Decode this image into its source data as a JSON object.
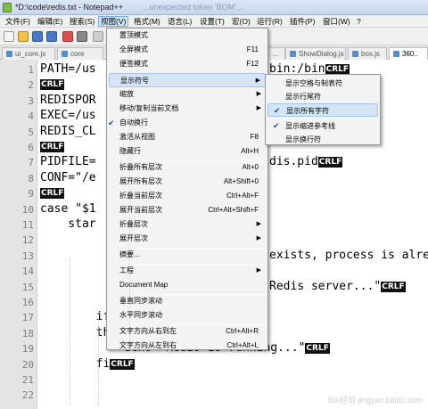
{
  "window": {
    "title": "*D:\\code\\redis.txt - Notepad++",
    "ghost_title": "...unexpected token 'BOM'..."
  },
  "menubar": {
    "items": [
      "文件(F)",
      "编辑(E)",
      "搜索(S)",
      "视图(V)",
      "格式(M)",
      "语言(L)",
      "设置(T)",
      "宏(O)",
      "运行(R)",
      "插件(P)",
      "窗口(W)",
      "?"
    ]
  },
  "tabs": [
    "ui_core.js",
    "core",
    "...",
    "ShowDialog.js",
    "box.js",
    "360.."
  ],
  "editor": {
    "line_numbers": [
      "1",
      "2",
      "3",
      "4",
      "5",
      "6",
      "7",
      "8",
      "9",
      "10",
      "11",
      "12",
      "13",
      "14",
      "15",
      "16",
      "17",
      "18",
      "19",
      "20",
      "21",
      "22"
    ],
    "lines": [
      {
        "text": "PATH=/us",
        "tail": "bin:/bin",
        "crlf": true
      },
      {
        "text": "",
        "crlf": true
      },
      {
        "text": "REDISPOR",
        "crlf": false
      },
      {
        "text": "EXEC=/us",
        "crlf": false
      },
      {
        "text": "REDIS_CL",
        "crlf": false
      },
      {
        "text": "",
        "crlf": true
      },
      {
        "text": "PIDFILE=",
        "tail": "dis.pid",
        "crlf": true
      },
      {
        "text": "CONF=\"/e",
        "crlf": false
      },
      {
        "text": "",
        "crlf": true
      },
      {
        "text": "case \"$1",
        "crlf": false
      },
      {
        "text": "    star",
        "crlf": false
      },
      {
        "text": "",
        "crlf": false
      },
      {
        "text": "",
        "tail": "exists, process is alre",
        "crlf": false
      },
      {
        "text": "",
        "crlf": false
      },
      {
        "text": "",
        "tail": "Redis server...\"",
        "crlf": true
      },
      {
        "text": "",
        "crlf": false
      },
      {
        "text": "        if [ \"$?\"=\"0\" ] ",
        "crlf": true
      },
      {
        "text": "        then",
        "crlf": true
      },
      {
        "text": "            echo \"Redis is running...\"",
        "crlf": true
      },
      {
        "text": "        fi",
        "crlf": true
      }
    ],
    "crlf_label": "CRLF"
  },
  "view_menu": {
    "items": [
      {
        "label": "置顶模式",
        "shortcut": ""
      },
      {
        "label": "全屏模式",
        "shortcut": "F11"
      },
      {
        "label": "便签模式",
        "shortcut": "F12"
      },
      {
        "label": "显示符号",
        "shortcut": "",
        "submenu": true
      },
      {
        "label": "缩放",
        "shortcut": "",
        "submenu": true
      },
      {
        "label": "移动/复制当前文档",
        "shortcut": "",
        "submenu": true
      },
      {
        "label": "自动换行",
        "shortcut": "",
        "checked": true
      },
      {
        "label": "激活从视图",
        "shortcut": "F8"
      },
      {
        "label": "隐藏行",
        "shortcut": "Alt+H"
      },
      {
        "label": "折叠所有层次",
        "shortcut": "Alt+0"
      },
      {
        "label": "展开所有层次",
        "shortcut": "Alt+Shift+0"
      },
      {
        "label": "折叠当前层次",
        "shortcut": "Ctrl+Alt+F"
      },
      {
        "label": "展开当前层次",
        "shortcut": "Ctrl+Alt+Shift+F"
      },
      {
        "label": "折叠层次",
        "shortcut": "",
        "submenu": true
      },
      {
        "label": "展开层次",
        "shortcut": "",
        "submenu": true
      },
      {
        "label": "摘要...",
        "shortcut": ""
      },
      {
        "label": "工程",
        "shortcut": "",
        "submenu": true
      },
      {
        "label": "Document Map",
        "shortcut": ""
      },
      {
        "label": "垂直同步滚动",
        "shortcut": ""
      },
      {
        "label": "水平同步滚动",
        "shortcut": ""
      },
      {
        "label": "文字方向从右到左",
        "shortcut": "Ctrl+Alt+R"
      },
      {
        "label": "文字方向从左到右",
        "shortcut": "Ctrl+Alt+L"
      }
    ]
  },
  "symbols_submenu": {
    "items": [
      {
        "label": "显示空格与制表符",
        "checked": false
      },
      {
        "label": "显示行尾符",
        "checked": false
      },
      {
        "label": "显示所有字符",
        "checked": true
      },
      {
        "label": "显示缩进参考线",
        "checked": true
      },
      {
        "label": "显示换行符",
        "checked": false
      }
    ]
  },
  "watermark": "Bai经验 jingyan.baidu.com",
  "colors": {
    "menu_highlight": "#d6e5f6",
    "crlf_bg": "#111111",
    "gutter_bg": "#e4e4e4"
  }
}
